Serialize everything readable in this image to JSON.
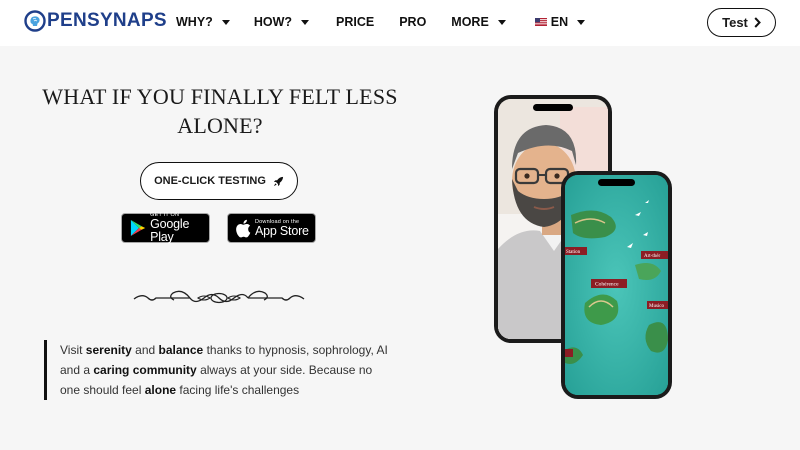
{
  "header": {
    "brand": "PENSYNAPS",
    "nav": [
      {
        "label": "WHY?",
        "dropdown": true
      },
      {
        "label": "HOW?",
        "dropdown": true
      },
      {
        "label": "PRICE",
        "dropdown": false
      },
      {
        "label": "PRO",
        "dropdown": false
      },
      {
        "label": "MORE",
        "dropdown": true
      }
    ],
    "language": {
      "label": "EN",
      "flag": "us-flag-icon"
    },
    "test_button": "Test"
  },
  "hero": {
    "title": "WHAT IF YOU FINALLY FELT LESS ALONE?",
    "cta_label": "ONE-CLICK TESTING",
    "google_play": {
      "small": "GET IT ON",
      "big": "Google Play"
    },
    "app_store": {
      "small": "Download on the",
      "big": "App Store"
    },
    "description_parts": [
      {
        "text": "Visit ",
        "bold": false
      },
      {
        "text": "serenity",
        "bold": true
      },
      {
        "text": " and ",
        "bold": false
      },
      {
        "text": "balance",
        "bold": true
      },
      {
        "text": " thanks to hypnosis, sophrology, AI and a ",
        "bold": false
      },
      {
        "text": "caring community",
        "bold": true
      },
      {
        "text": " always at your side. Because no one should feel ",
        "bold": false
      },
      {
        "text": "alone",
        "bold": true
      },
      {
        "text": " facing life's challenges",
        "bold": false
      }
    ]
  },
  "map_labels": [
    "Station",
    "Art-thér",
    "Cohérence",
    "Musico"
  ],
  "colors": {
    "brand": "#1f3f8a",
    "background": "#f6f6f6",
    "sea": "#2bb3a8",
    "banner": "#8c1d24"
  }
}
